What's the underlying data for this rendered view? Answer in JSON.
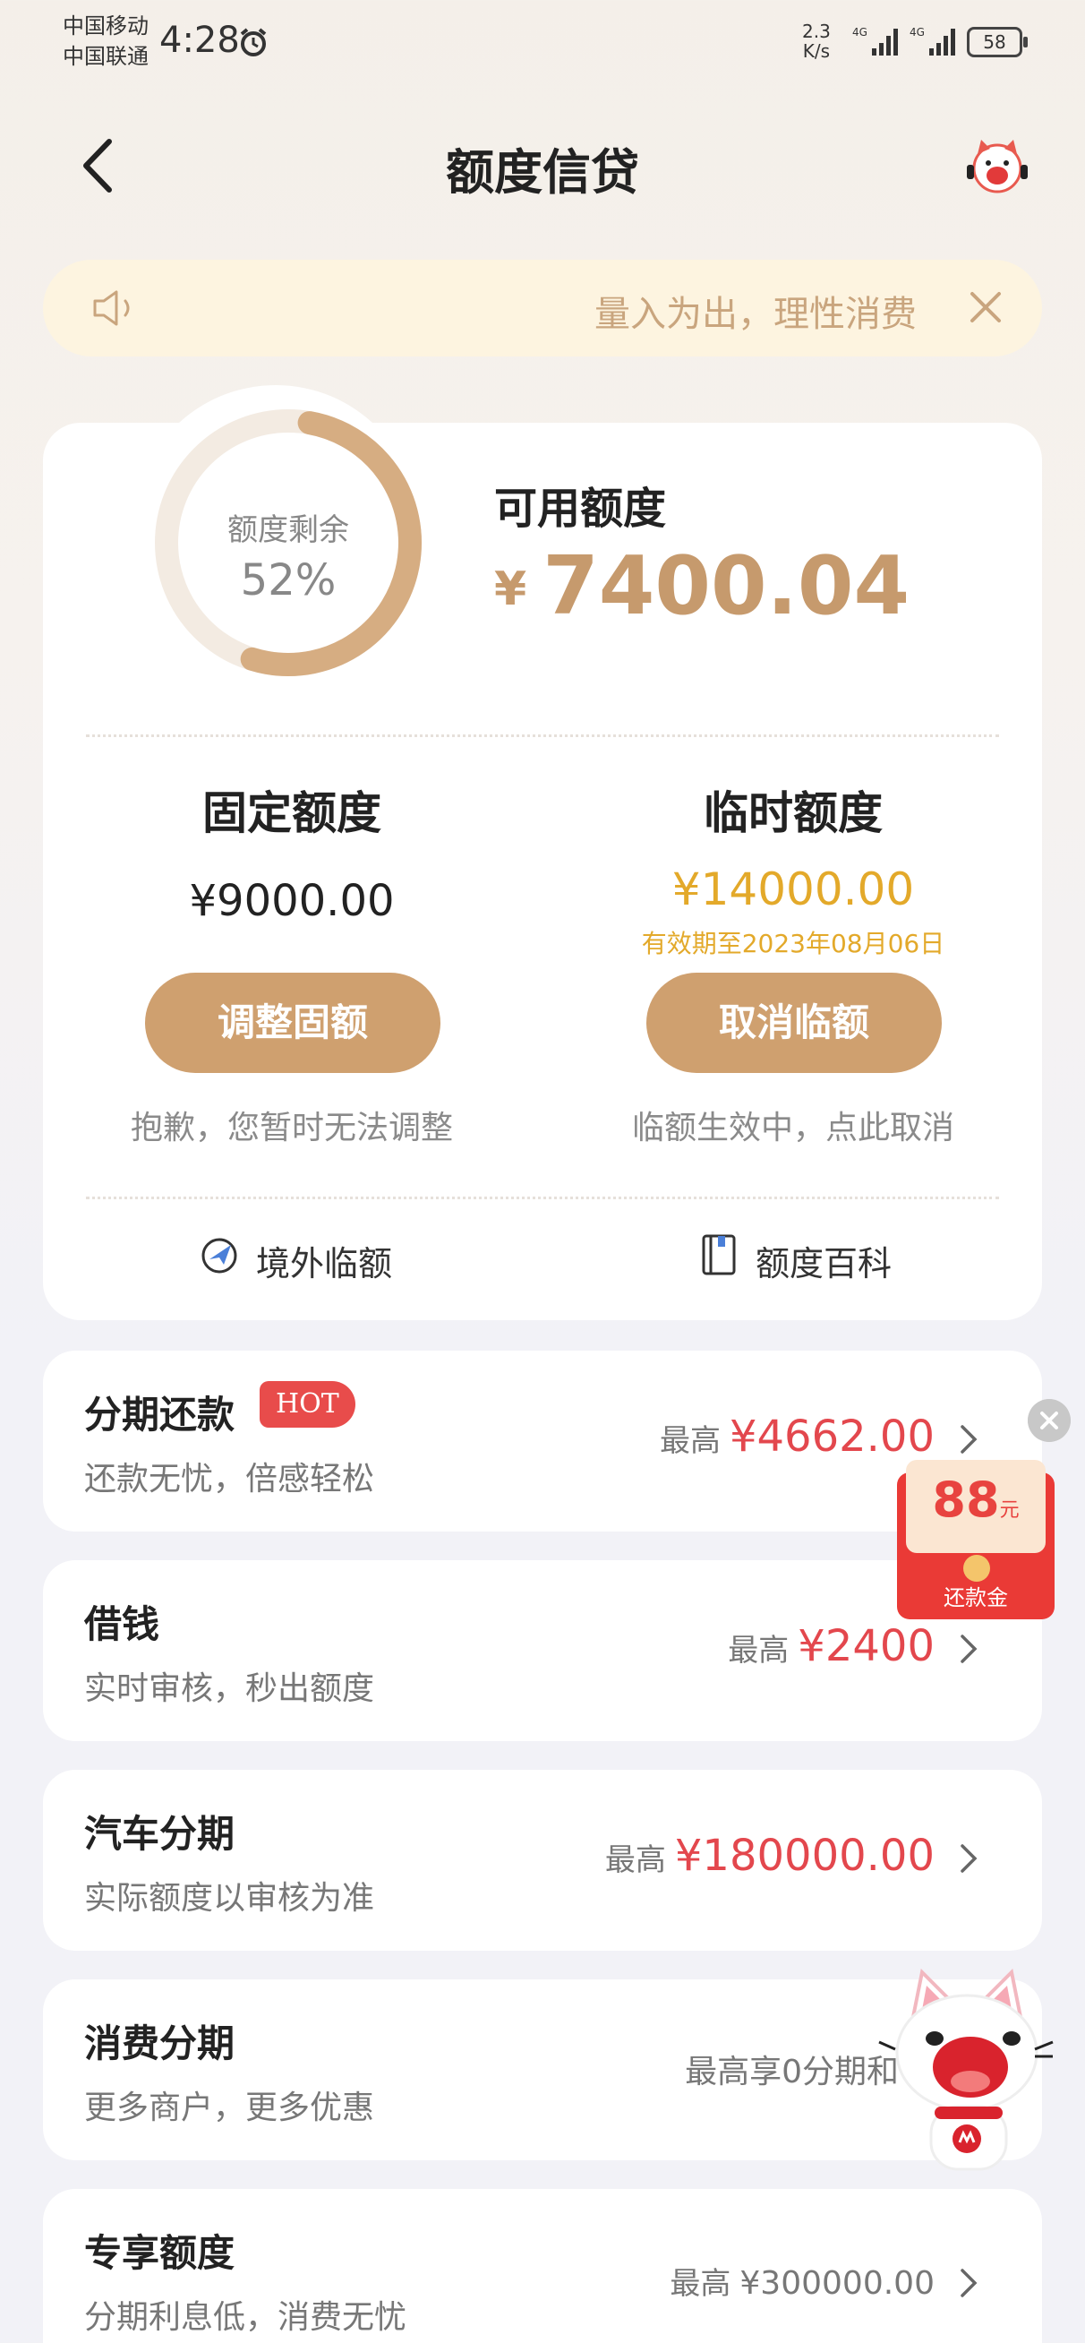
{
  "status_bar": {
    "carrier1": "中国移动",
    "carrier2": "中国联通",
    "time": "4:28",
    "net_speed_value": "2.3",
    "net_speed_unit": "K/s",
    "battery": "58"
  },
  "header": {
    "title": "额度信贷"
  },
  "notice": {
    "text": "量入为出，理性消费"
  },
  "credit": {
    "ring_label": "额度剩余",
    "ring_percent": "52%",
    "ring_fraction": 0.52,
    "available_label": "可用额度",
    "available_currency": "¥",
    "available_amount": "7400.04",
    "fixed_title": "固定额度",
    "fixed_amount": "¥9000.00",
    "fixed_button": "调整固额",
    "fixed_note": "抱歉，您暂时无法调整",
    "temp_title": "临时额度",
    "temp_amount": "¥14000.00",
    "temp_valid": "有效期至2023年08月06日",
    "temp_button": "取消临额",
    "temp_note": "临额生效中，点此取消",
    "link_overseas": "境外临额",
    "link_wiki": "额度百科"
  },
  "features": [
    {
      "title": "分期还款",
      "badge": "HOT",
      "subtitle": "还款无忧，倍感轻松",
      "prefix": "最高",
      "amount": "¥4662.00"
    },
    {
      "title": "借钱",
      "subtitle": "实时审核，秒出额度",
      "prefix": "最高",
      "amount": "¥2400"
    },
    {
      "title": "汽车分期",
      "subtitle": "实际额度以审核为准",
      "prefix": "最高",
      "amount": "¥180000.00"
    },
    {
      "title": "消费分期",
      "subtitle": "更多商户，更多优惠",
      "prefix": "",
      "amount": "最高享0分期和"
    },
    {
      "title": "专享额度",
      "subtitle": "分期利息低，消费无忧",
      "prefix": "最高",
      "amount": "¥300000.00"
    }
  ],
  "red_packet": {
    "amount": "88",
    "unit": "元",
    "label": "还款金"
  },
  "colors": {
    "gold": "#cfa06f",
    "amount_red": "#e3474d",
    "temp_yellow": "#e3a92a"
  },
  "icons": [
    "alarm-icon",
    "signal-icon",
    "back-icon",
    "mascot-icon",
    "speaker-icon",
    "close-icon",
    "globe-plane-icon",
    "book-icon",
    "chevron-right-icon"
  ]
}
